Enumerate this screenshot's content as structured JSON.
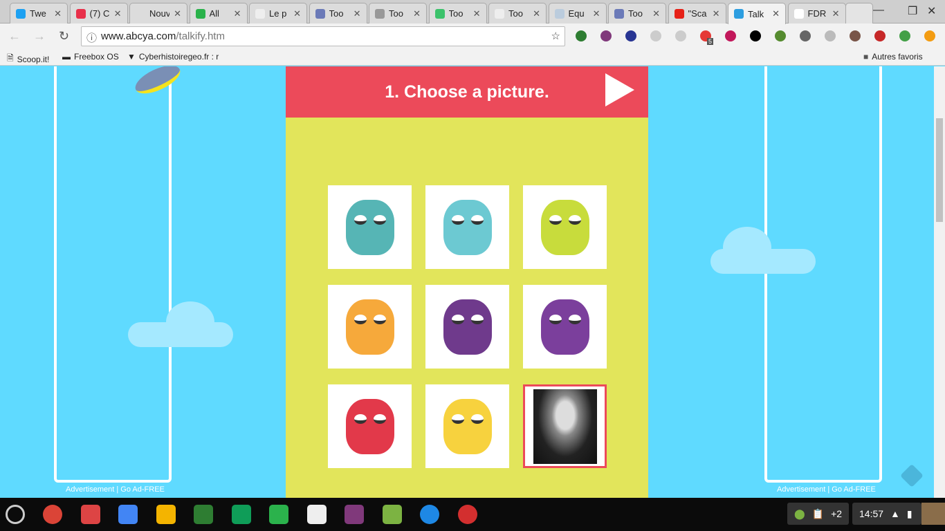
{
  "browser": {
    "tabs": [
      {
        "title": "Twe",
        "color": "#1da1f2"
      },
      {
        "title": "(7) C",
        "color": "#e8304a"
      },
      {
        "title": "Nouvel o",
        "color": "#dcdcdc"
      },
      {
        "title": "All",
        "color": "#2ab24b"
      },
      {
        "title": "Le p",
        "color": "#eee"
      },
      {
        "title": "Too",
        "color": "#6b7ab8"
      },
      {
        "title": "Too",
        "color": "#999"
      },
      {
        "title": "Too",
        "color": "#3bc26b"
      },
      {
        "title": "Too",
        "color": "#eee"
      },
      {
        "title": "Equ",
        "color": "#bcd"
      },
      {
        "title": "Too",
        "color": "#6b7ab8"
      },
      {
        "title": "\"Sca",
        "color": "#e62117"
      },
      {
        "title": "Talk",
        "color": "#2d9ee0",
        "active": true
      },
      {
        "title": "FDR",
        "color": "#fff"
      }
    ],
    "url_domain": "www.abcya.com",
    "url_path": "/talkify.htm",
    "extension_badge": "5",
    "bookmarks": [
      "Scoop.it!",
      "Freebox OS",
      "Cyberhistoiregeo.fr : r"
    ],
    "other_bookmarks": "Autres favoris"
  },
  "page": {
    "heading": "1. Choose a picture.",
    "pictures": [
      {
        "name": "teal-three-eyed-monster",
        "color": "#56b5b5"
      },
      {
        "name": "cyan-spiky-monster",
        "color": "#6cc9d2"
      },
      {
        "name": "lime-antenna-monster",
        "color": "#c8dc3c"
      },
      {
        "name": "orange-spotted-monster",
        "color": "#f6a93b"
      },
      {
        "name": "purple-three-eyed-monster",
        "color": "#6f3a8c"
      },
      {
        "name": "purple-horned-monster",
        "color": "#7b3f9c"
      },
      {
        "name": "red-devil-monster",
        "color": "#e2394a"
      },
      {
        "name": "yellow-pineapple-monster",
        "color": "#f7d23e"
      },
      {
        "name": "fdr-portrait",
        "color": "#333333",
        "selected": true
      }
    ],
    "ad_label": "Advertisement",
    "ad_free": "Go Ad-FREE",
    "colors": {
      "sky": "#5fdaff",
      "header": "#ec4a5a",
      "panel": "#e2e55b"
    }
  },
  "taskbar": {
    "apps": [
      {
        "name": "chrome",
        "color": "#db4437"
      },
      {
        "name": "gmail",
        "color": "#d44"
      },
      {
        "name": "docs",
        "color": "#4285f4"
      },
      {
        "name": "slides",
        "color": "#f4b400"
      },
      {
        "name": "app",
        "color": "#2e7d32"
      },
      {
        "name": "drive",
        "color": "#0f9d58"
      },
      {
        "name": "feedly",
        "color": "#2bb24c"
      },
      {
        "name": "play-store",
        "color": "#eee"
      },
      {
        "name": "onenote",
        "color": "#80397b"
      },
      {
        "name": "turtle",
        "color": "#7cb342"
      },
      {
        "name": "files",
        "color": "#1e88e5"
      },
      {
        "name": "photos",
        "color": "#d32f2f"
      }
    ],
    "notif_count": "+2",
    "time": "14:57"
  }
}
